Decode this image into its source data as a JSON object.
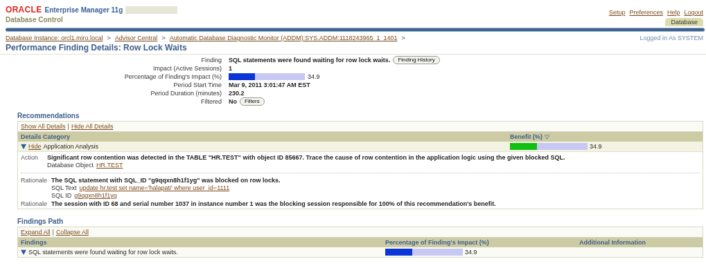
{
  "header": {
    "brand": "ORACLE",
    "product": "Enterprise Manager 11g",
    "subtitle": "Database Control",
    "global_links": [
      "Setup",
      "Preferences",
      "Help",
      "Logout"
    ],
    "tabs": [
      {
        "label": "Database",
        "selected": true
      }
    ]
  },
  "breadcrumb": [
    {
      "kind": "link",
      "text": "Database Instance: orcl1.miro.local"
    },
    {
      "kind": "sep",
      "text": ">"
    },
    {
      "kind": "link",
      "text": "Advisor Central"
    },
    {
      "kind": "sep",
      "text": ">"
    },
    {
      "kind": "link",
      "text": "Automatic Database Diagnostic Monitor (ADDM):SYS.ADDM:1118243965_1_1401"
    },
    {
      "kind": "sep",
      "text": ">"
    }
  ],
  "login_status": "Logged in As SYSTEM",
  "page_title": "Performance Finding Details: Row Lock Waits",
  "details": [
    {
      "label": "Finding",
      "kind": "text",
      "value": "SQL statements were found waiting for row lock waits.",
      "button": "Finding History"
    },
    {
      "label": "Impact (Active Sessions)",
      "kind": "text",
      "value": "1"
    },
    {
      "label": "Percentage of Finding's Impact (%)",
      "kind": "bar",
      "level": 0.349,
      "reading": "34.9"
    },
    {
      "label": "Period Start Time",
      "kind": "text",
      "value": "Mar 9, 2011 3:01:47 AM EST"
    },
    {
      "label": "Period Duration (minutes)",
      "kind": "text",
      "value": "230.2"
    },
    {
      "label": "Filtered",
      "kind": "text",
      "value": "No",
      "button": "Filters"
    }
  ],
  "recommendations": {
    "title": "Recommendations",
    "links": [
      {
        "kind": "link",
        "text": "Show All Details"
      },
      {
        "kind": "sep",
        "text": "|"
      },
      {
        "kind": "link",
        "text": "Hide All Details"
      }
    ],
    "columns": [
      "Details Category",
      "Benefit (%)"
    ],
    "rows": [
      {
        "toggle": "Hide",
        "expanded": true,
        "category": "Application Analysis",
        "level": 0.349,
        "reading": "34.9",
        "details": [
          {
            "kind": "entry",
            "label": "Action",
            "text": "Significant row contention was detected in the TABLE \"HR.TEST\" with object ID 85667. Trace the cause of row contention in the application logic using the given blocked SQL.",
            "sub": [
              {
                "label": "Database Object",
                "link": "HR.TEST"
              }
            ]
          },
          {
            "kind": "divider"
          },
          {
            "kind": "entry",
            "label": "Rationale",
            "text": "The SQL statement with SQL_ID \"g9qqxn8h1f1yg\" was blocked on row locks.",
            "sub": [
              {
                "label": "SQL Text",
                "link": "update hr.test set name='halapati' where user_id=1111"
              },
              {
                "label": "SQL ID",
                "link": "g9qqxn8h1f1yg"
              }
            ]
          },
          {
            "kind": "entry",
            "label": "Rationale",
            "text": "The session with ID 68 and serial number 1037 in instance number 1 was the blocking session responsible for 100% of this recommendation's benefit."
          }
        ]
      }
    ]
  },
  "findings_path": {
    "title": "Findings Path",
    "links": [
      {
        "kind": "link",
        "text": "Expand All"
      },
      {
        "kind": "sep",
        "text": "|"
      },
      {
        "kind": "link",
        "text": "Collapse All"
      }
    ],
    "columns": [
      "Findings",
      "Percentage of Finding's Impact (%)",
      "Additional Information"
    ],
    "rows": [
      {
        "expanded": true,
        "text": "SQL statements were found waiting for row lock waits.",
        "level": 0.349,
        "reading": "34.9"
      }
    ]
  }
}
